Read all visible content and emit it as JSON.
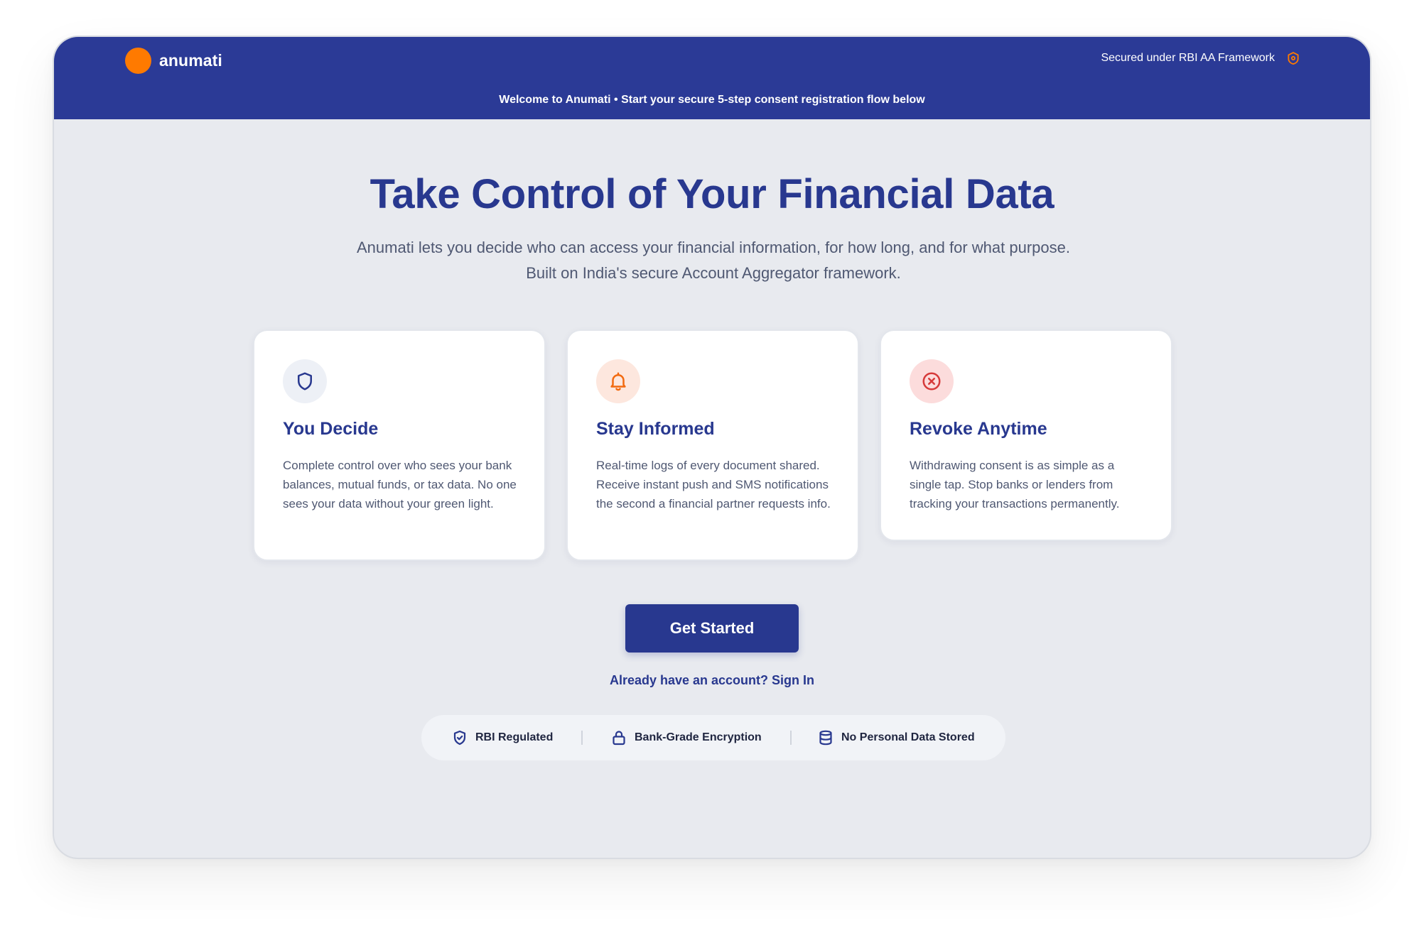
{
  "header": {
    "brand_name": "anumati",
    "secured_text": "Secured under RBI AA Framework",
    "secured_icon": "shield-icon",
    "welcome_text": "Welcome to Anumati • Start your secure 5-step consent registration flow below"
  },
  "hero": {
    "title": "Take Control of Your Financial Data",
    "subtitle": "Anumati lets you decide who can access your financial information, for how long, and for what purpose. Built on India's secure Account Aggregator framework."
  },
  "cards": [
    {
      "icon": "shield-icon",
      "title": "You Decide",
      "text": "Complete control over who sees your bank balances, mutual funds, or tax data. No one sees your data without your green light."
    },
    {
      "icon": "bell-icon",
      "title": "Stay Informed",
      "text": "Real-time logs of every document shared. Receive instant push and SMS notifications the second a financial partner requests info."
    },
    {
      "icon": "x-circle-icon",
      "title": "Revoke Anytime",
      "text": "Withdrawing consent is as simple as a single tap. Stop banks or lenders from tracking your transactions permanently."
    }
  ],
  "cta": {
    "get_started_label": "Get Started",
    "signin_label": "Already have an account? Sign In"
  },
  "trust_badges": [
    {
      "icon": "shield-check-icon",
      "label": "RBI Regulated"
    },
    {
      "icon": "lock-icon",
      "label": "Bank-Grade Encryption"
    },
    {
      "icon": "database-icon",
      "label": "No Personal Data Stored"
    }
  ],
  "colors": {
    "brand_blue": "#2b3a96",
    "heading_blue": "#28388f",
    "accent_orange": "#ff7a00",
    "alert_red": "#d63a3a",
    "page_background": "#e8eaef"
  }
}
